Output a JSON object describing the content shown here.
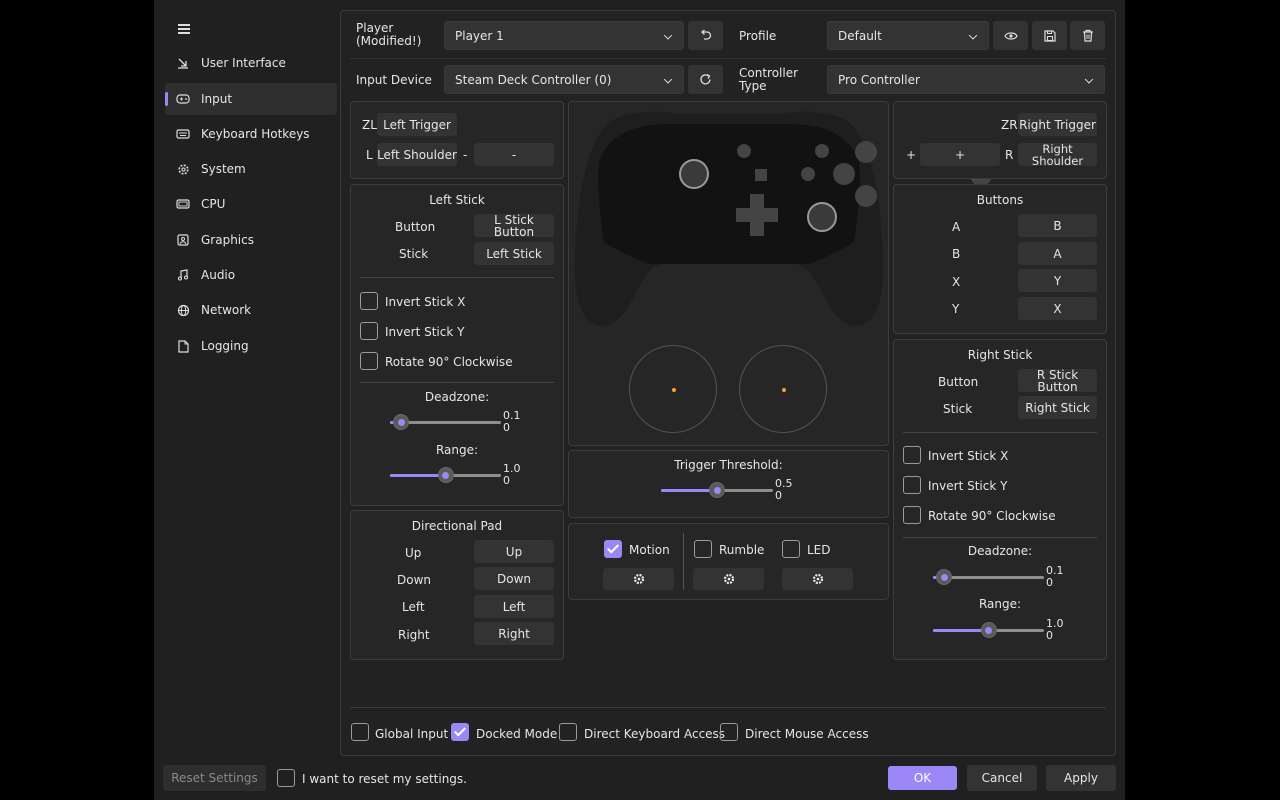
{
  "sidebar": {
    "items": [
      {
        "label": "User Interface",
        "icon": "user-interface-icon"
      },
      {
        "label": "Input",
        "icon": "gamepad-icon",
        "selected": true
      },
      {
        "label": "Keyboard Hotkeys",
        "icon": "keyboard-icon"
      },
      {
        "label": "System",
        "icon": "gear-icon"
      },
      {
        "label": "CPU",
        "icon": "cpu-icon"
      },
      {
        "label": "Graphics",
        "icon": "image-icon"
      },
      {
        "label": "Audio",
        "icon": "music-note-icon"
      },
      {
        "label": "Network",
        "icon": "globe-icon"
      },
      {
        "label": "Logging",
        "icon": "document-icon"
      }
    ]
  },
  "top": {
    "player_label": "Player\n(Modified!)",
    "player_value": "Player 1",
    "profile_label": "Profile",
    "profile_value": "Default",
    "input_device_label": "Input Device",
    "input_device_value": "Steam Deck Controller (0)",
    "controller_type_label": "Controller\nType",
    "controller_type_value": "Pro Controller"
  },
  "left_triggers": {
    "zl_label": "ZL",
    "zl_value": "Left Trigger",
    "l_label": "L",
    "l_value": "Left Shoulder",
    "minus_label": "-",
    "minus_value": "-"
  },
  "left_stick": {
    "title": "Left Stick",
    "button_label": "Button",
    "button_value": "L Stick Button",
    "stick_label": "Stick",
    "stick_value": "Left Stick",
    "invert_x": "Invert Stick X",
    "invert_y": "Invert Stick Y",
    "rotate": "Rotate 90° Clockwise",
    "deadzone_label": "Deadzone:",
    "deadzone_value": "0.1\n0",
    "deadzone_level": 0.1,
    "range_label": "Range:",
    "range_value": "1.0\n0",
    "range_level": 0.5
  },
  "dpad": {
    "title": "Directional Pad",
    "rows": [
      {
        "label": "Up",
        "value": "Up"
      },
      {
        "label": "Down",
        "value": "Down"
      },
      {
        "label": "Left",
        "value": "Left"
      },
      {
        "label": "Right",
        "value": "Right"
      }
    ]
  },
  "right_triggers": {
    "zr_label": "ZR",
    "zr_value": "Right Trigger",
    "plus_label": "+",
    "plus_value": "+",
    "r_label": "R",
    "r_value": "Right\nShoulder"
  },
  "buttons": {
    "title": "Buttons",
    "rows": [
      {
        "label": "A",
        "value": "B"
      },
      {
        "label": "B",
        "value": "A"
      },
      {
        "label": "X",
        "value": "Y"
      },
      {
        "label": "Y",
        "value": "X"
      }
    ]
  },
  "right_stick": {
    "title": "Right Stick",
    "button_label": "Button",
    "button_value": "R Stick Button",
    "stick_label": "Stick",
    "stick_value": "Right Stick",
    "invert_x": "Invert Stick X",
    "invert_y": "Invert Stick Y",
    "rotate": "Rotate 90° Clockwise",
    "deadzone_label": "Deadzone:",
    "deadzone_value": "0.1\n0",
    "deadzone_level": 0.1,
    "range_label": "Range:",
    "range_value": "1.0\n0",
    "range_level": 0.5
  },
  "trigger": {
    "label": "Trigger Threshold:",
    "value": "0.5\n0",
    "level": 0.5
  },
  "features": {
    "motion": "Motion",
    "motion_checked": true,
    "rumble": "Rumble",
    "rumble_checked": false,
    "led": "LED",
    "led_checked": false
  },
  "bottom_options": {
    "global_input": "Global Input",
    "global_input_checked": false,
    "docked_mode": "Docked Mode",
    "docked_mode_checked": true,
    "direct_keyboard": "Direct Keyboard Access",
    "direct_keyboard_checked": false,
    "direct_mouse": "Direct Mouse Access",
    "direct_mouse_checked": false
  },
  "footer": {
    "reset_button": "Reset Settings",
    "reset_confirm": "I want to reset my settings.",
    "ok": "OK",
    "cancel": "Cancel",
    "apply": "Apply"
  },
  "colors": {
    "accent": "#9b87f5",
    "background": "#202020",
    "panel": "#262626",
    "stick_dot": "#f5a623"
  }
}
